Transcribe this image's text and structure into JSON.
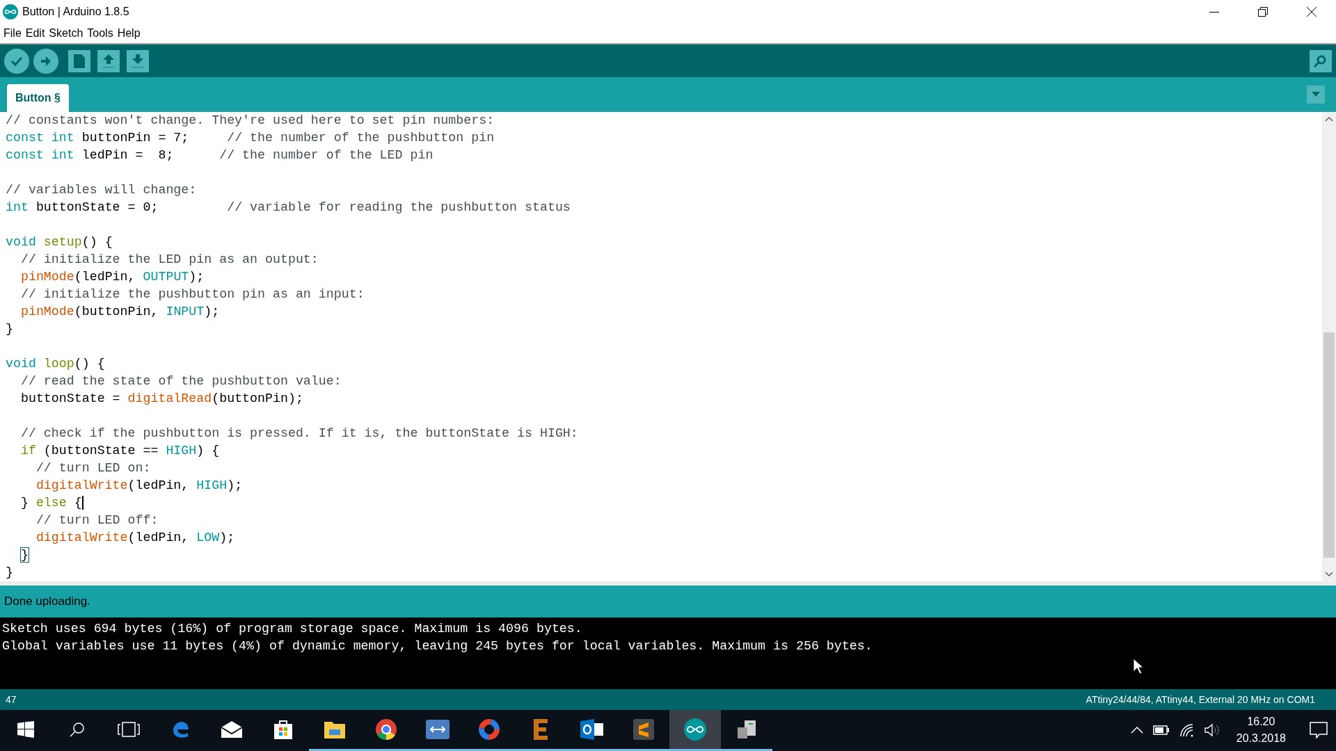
{
  "window": {
    "title": "Button | Arduino 1.8.5"
  },
  "menu": [
    "File",
    "Edit",
    "Sketch",
    "Tools",
    "Help"
  ],
  "tabs": [
    {
      "label": "Button §",
      "selected": true
    }
  ],
  "code": [
    {
      "lines": [
        {
          "segments": [
            {
              "kind": "comment",
              "text": "// constants won't change. They're used here to set pin numbers:"
            }
          ]
        },
        {
          "segments": [
            {
              "kind": "type",
              "text": "const"
            },
            {
              "kind": "type",
              "text": " int"
            },
            {
              "kind": "plain",
              "text": " buttonPin = 7;     "
            },
            {
              "kind": "comment",
              "text": "// the number of the pushbutton pin"
            }
          ]
        },
        {
          "segments": [
            {
              "kind": "type",
              "text": "const"
            },
            {
              "kind": "type",
              "text": " int"
            },
            {
              "kind": "plain",
              "text": " ledPin =  8;      "
            },
            {
              "kind": "comment",
              "text": "// the number of the LED pin"
            }
          ]
        }
      ]
    },
    {
      "lines": [
        {
          "segments": [
            {
              "kind": "comment",
              "text": "// variables will change:"
            }
          ]
        },
        {
          "segments": [
            {
              "kind": "type",
              "text": "int"
            },
            {
              "kind": "plain",
              "text": " buttonState = 0;         "
            },
            {
              "kind": "comment",
              "text": "// variable for reading the pushbutton status"
            }
          ]
        }
      ]
    },
    {
      "lines": [
        {
          "segments": [
            {
              "kind": "type",
              "text": "void"
            },
            {
              "kind": "control",
              "text": " setup"
            },
            {
              "kind": "plain",
              "text": "() {"
            }
          ]
        },
        {
          "segments": [
            {
              "kind": "comment",
              "text": "  // initialize the LED pin as an output:"
            }
          ]
        },
        {
          "segments": [
            {
              "kind": "func",
              "text": "  pinMode"
            },
            {
              "kind": "plain",
              "text": "(ledPin, "
            },
            {
              "kind": "type",
              "text": "OUTPUT"
            },
            {
              "kind": "plain",
              "text": ");"
            }
          ]
        },
        {
          "segments": [
            {
              "kind": "comment",
              "text": "  // initialize the pushbutton pin as an input:"
            }
          ]
        },
        {
          "segments": [
            {
              "kind": "func",
              "text": "  pinMode"
            },
            {
              "kind": "plain",
              "text": "(buttonPin, "
            },
            {
              "kind": "type",
              "text": "INPUT"
            },
            {
              "kind": "plain",
              "text": ");"
            }
          ]
        },
        {
          "segments": [
            {
              "kind": "plain",
              "text": "}"
            }
          ]
        }
      ]
    },
    {
      "lines": [
        {
          "segments": [
            {
              "kind": "type",
              "text": "void"
            },
            {
              "kind": "control",
              "text": " loop"
            },
            {
              "kind": "plain",
              "text": "() {"
            }
          ]
        },
        {
          "segments": [
            {
              "kind": "comment",
              "text": "  // read the state of the pushbutton value:"
            }
          ]
        },
        {
          "segments": [
            {
              "kind": "plain",
              "text": "  buttonState = "
            },
            {
              "kind": "func",
              "text": "digitalRead"
            },
            {
              "kind": "plain",
              "text": "(buttonPin);"
            }
          ]
        }
      ]
    },
    {
      "lines": [
        {
          "segments": [
            {
              "kind": "comment",
              "text": "  // check if the pushbutton is pressed. If it is, the buttonState is HIGH:"
            }
          ]
        },
        {
          "segments": [
            {
              "kind": "control",
              "text": "  if"
            },
            {
              "kind": "plain",
              "text": " (buttonState == "
            },
            {
              "kind": "type",
              "text": "HIGH"
            },
            {
              "kind": "plain",
              "text": ") {"
            }
          ]
        },
        {
          "segments": [
            {
              "kind": "comment",
              "text": "    // turn LED on:"
            }
          ]
        },
        {
          "segments": [
            {
              "kind": "func",
              "text": "    digitalWrite"
            },
            {
              "kind": "plain",
              "text": "(ledPin, "
            },
            {
              "kind": "type",
              "text": "HIGH"
            },
            {
              "kind": "plain",
              "text": ");"
            }
          ]
        },
        {
          "segments": [
            {
              "kind": "plain",
              "text": "  } "
            },
            {
              "kind": "control",
              "text": "else"
            },
            {
              "kind": "plain",
              "text": " {"
            }
          ],
          "cursor": true
        },
        {
          "segments": [
            {
              "kind": "comment",
              "text": "    // turn LED off:"
            }
          ]
        },
        {
          "segments": [
            {
              "kind": "func",
              "text": "    digitalWrite"
            },
            {
              "kind": "plain",
              "text": "(ledPin, "
            },
            {
              "kind": "type",
              "text": "LOW"
            },
            {
              "kind": "plain",
              "text": ");"
            }
          ]
        },
        {
          "segments": [
            {
              "kind": "bracket",
              "text": "  }"
            }
          ]
        },
        {
          "segments": [
            {
              "kind": "plain",
              "text": "}"
            }
          ]
        }
      ]
    }
  ],
  "message": "Done uploading.",
  "console": [
    "Sketch uses 694 bytes (16%) of program storage space. Maximum is 4096 bytes.",
    "Global variables use 11 bytes (4%) of dynamic memory, leaving 245 bytes for local variables. Maximum is 256 bytes."
  ],
  "status_bar": {
    "line": "47",
    "board": "ATtiny24/44/84, ATtiny44, External 20 MHz on COM1"
  },
  "taskbar": {
    "apps": [
      {
        "kind": "edge",
        "running": false,
        "selected": false
      },
      {
        "kind": "mail",
        "running": false,
        "selected": false
      },
      {
        "kind": "store",
        "running": false,
        "selected": false
      },
      {
        "kind": "folder",
        "running": true,
        "selected": false
      },
      {
        "kind": "chrome",
        "running": true,
        "selected": false
      },
      {
        "kind": "remote",
        "running": true,
        "selected": false
      },
      {
        "kind": "ring",
        "running": true,
        "selected": false
      },
      {
        "kind": "letter",
        "running": true,
        "selected": false
      },
      {
        "kind": "outlook",
        "running": true,
        "selected": false
      },
      {
        "kind": "sublime",
        "running": true,
        "selected": false
      },
      {
        "kind": "arduino",
        "running": true,
        "selected": true
      },
      {
        "kind": "network",
        "running": true,
        "selected": false
      }
    ],
    "time": "16.20",
    "date": "20.3.2018"
  }
}
